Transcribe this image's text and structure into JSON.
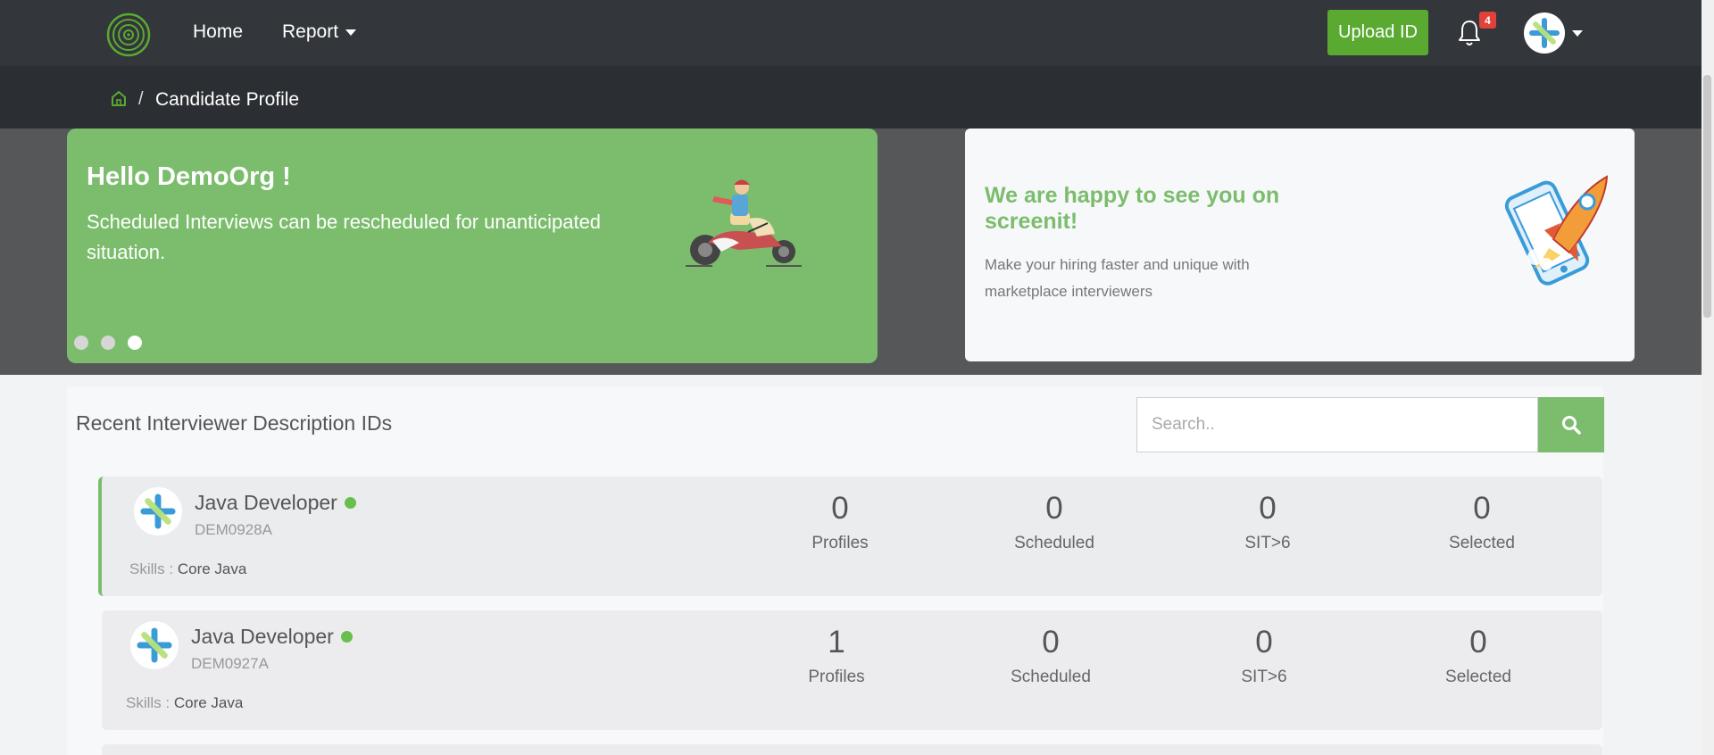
{
  "nav": {
    "home": "Home",
    "report": "Report",
    "upload": "Upload ID",
    "notification_count": "4"
  },
  "breadcrumb": {
    "current": "Candidate Profile",
    "separator": "/"
  },
  "banner": {
    "title": "Hello DemoOrg !",
    "text": "Scheduled Interviews can be rescheduled for unanticipated situation.",
    "dots": 3,
    "active_dot": 3
  },
  "welcome": {
    "title": "We are happy to see you on screenit!",
    "text": "Make your hiring faster and unique with marketplace interviewers"
  },
  "section": {
    "title": "Recent Interviewer Description IDs",
    "search_placeholder": "Search.."
  },
  "jobs": [
    {
      "title": "Java Developer",
      "code": "DEM0928A",
      "skills_label": "Skills : ",
      "skills": "Core Java",
      "stats": [
        {
          "value": "0",
          "label": "Profiles"
        },
        {
          "value": "0",
          "label": "Scheduled"
        },
        {
          "value": "0",
          "label": "SIT>6"
        },
        {
          "value": "0",
          "label": "Selected"
        }
      ]
    },
    {
      "title": "Java Developer",
      "code": "DEM0927A",
      "skills_label": "Skills : ",
      "skills": "Core Java",
      "stats": [
        {
          "value": "1",
          "label": "Profiles"
        },
        {
          "value": "0",
          "label": "Scheduled"
        },
        {
          "value": "0",
          "label": "SIT>6"
        },
        {
          "value": "0",
          "label": "Selected"
        }
      ]
    }
  ],
  "colors": {
    "navbar": "#33363b",
    "accent": "#7bbd6c",
    "upload_button": "#5aaa32",
    "badge": "#e2403a"
  }
}
